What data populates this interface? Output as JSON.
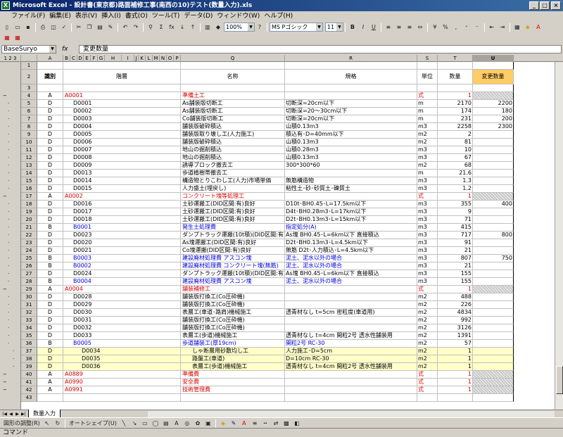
{
  "window": {
    "title": "Microsoft Excel - 設計書(東京都)路面補修工事(南西の10)テスト(数量入力).xls",
    "app_icon": "X",
    "min": "_",
    "max": "□",
    "close": "×"
  },
  "menu": [
    "ファイル(F)",
    "編集(E)",
    "表示(V)",
    "挿入(I)",
    "書式(O)",
    "ツール(T)",
    "データ(D)",
    "ウィンドウ(W)",
    "ヘルプ(H)"
  ],
  "toolbar": {
    "zoom": "100%",
    "font": "MS Pゴシック",
    "size": "11",
    "bold": "B",
    "italic": "I",
    "underline": "U",
    "percent": "%",
    "comma": ",",
    "sum": "Σ",
    "fx": "fx"
  },
  "namebox": "BaseSuryo",
  "formula_label": "fx",
  "formula": "変更数量",
  "columns": [
    "A",
    "B",
    "C",
    "D",
    "E",
    "F",
    "G",
    "H",
    "I",
    "J",
    "K",
    "L",
    "M",
    "N",
    "O",
    "P",
    "Q",
    "R",
    "S",
    "T",
    "U"
  ],
  "outline_levels": [
    "1",
    "2",
    "3"
  ],
  "header": {
    "code": "識別",
    "level": "階層",
    "name": "名称",
    "spec": "規格",
    "unit": "単位",
    "qty": "数量",
    "chg": "変更数量"
  },
  "rows": [
    {
      "n": "1"
    },
    {
      "n": "2",
      "header": true
    },
    {
      "n": "3"
    },
    {
      "n": "4",
      "a": "A",
      "code": "A0001",
      "ind": 0,
      "name": "準備土工",
      "unit": "式",
      "qty": "1",
      "color": "red",
      "hatch": true
    },
    {
      "n": "5",
      "a": "D",
      "code": "D0001",
      "ind": 1,
      "name": "As舗装版切断工",
      "spec": "切断深=20cm以下",
      "unit": "m",
      "qty": "2170",
      "chg": "2200"
    },
    {
      "n": "6",
      "a": "D",
      "code": "D0002",
      "ind": 1,
      "name": "As舗装版切断工",
      "spec": "切断深=20～30cm以下",
      "unit": "m",
      "qty": "174",
      "chg": "180"
    },
    {
      "n": "7",
      "a": "D",
      "code": "D0003",
      "ind": 1,
      "name": "Co舗装版切断工",
      "spec": "切断深=20cm以下",
      "unit": "m",
      "qty": "231",
      "chg": "200"
    },
    {
      "n": "8",
      "a": "D",
      "code": "D0004",
      "ind": 1,
      "name": "舗装版破砕積込",
      "spec": "山積0.13m3",
      "unit": "m3",
      "qty": "2258",
      "chg": "2300"
    },
    {
      "n": "9",
      "a": "D",
      "code": "D0005",
      "ind": 1,
      "name": "舗装版取り壊し工(人力施工)",
      "spec": "積込有･D=40mm以下",
      "unit": "m2",
      "qty": "2"
    },
    {
      "n": "10",
      "a": "D",
      "code": "D0006",
      "ind": 1,
      "name": "舗装版破砕積込",
      "spec": "山積0.13m3",
      "unit": "m2",
      "qty": "81"
    },
    {
      "n": "11",
      "a": "D",
      "code": "D0007",
      "ind": 1,
      "name": "地山の掘削積込",
      "spec": "山積0.28m3",
      "unit": "m3",
      "qty": "10"
    },
    {
      "n": "12",
      "a": "D",
      "code": "D0008",
      "ind": 1,
      "name": "地山の掘削積込",
      "spec": "山積0.13m3",
      "unit": "m3",
      "qty": "67"
    },
    {
      "n": "13",
      "a": "D",
      "code": "D0009",
      "ind": 1,
      "name": "誘導ブロック撤去工",
      "spec": "300*300*60",
      "unit": "m2",
      "qty": "68"
    },
    {
      "n": "14",
      "a": "D",
      "code": "D0013",
      "ind": 1,
      "name": "歩道植樹帯撤去工",
      "unit": "m",
      "qty": "21.6"
    },
    {
      "n": "15",
      "a": "D",
      "code": "D0014",
      "ind": 1,
      "name": "構造物とりこわし工(人力)市場単価",
      "spec": "無筋構造物",
      "unit": "m3",
      "qty": "1.3"
    },
    {
      "n": "16",
      "a": "D",
      "code": "D0015",
      "ind": 1,
      "name": "人力盛土(埋戻し)",
      "spec": "粘性土･砂･砂質土･礫質土",
      "unit": "m3",
      "qty": "1.2"
    },
    {
      "n": "17",
      "a": "A",
      "code": "A0002",
      "ind": 0,
      "name": "コンクリート塊等処理工",
      "unit": "式",
      "qty": "1",
      "color": "red",
      "hatch": true
    },
    {
      "n": "18",
      "a": "D",
      "code": "D0016",
      "ind": 1,
      "name": "土砂運搬工(DID区間:有)良好",
      "spec": "D10t･BH0.45･L=17.5km以下",
      "unit": "m3",
      "qty": "355",
      "chg": "400"
    },
    {
      "n": "19",
      "a": "D",
      "code": "D0017",
      "ind": 1,
      "name": "土砂運搬工(DID区間:有)良好",
      "spec": "D4t･BH0.28m3･L=17km以下",
      "unit": "m3",
      "qty": "9"
    },
    {
      "n": "20",
      "a": "D",
      "code": "D0018",
      "ind": 1,
      "name": "土砂運搬工(DID区間:有)良好",
      "spec": "D2t･BH0.13m3･L=15km以下",
      "unit": "m3",
      "qty": "71"
    },
    {
      "n": "21",
      "a": "B",
      "code": "B0001",
      "ind": 1,
      "name": "発生土処理費",
      "spec": "指定処分(A)",
      "unit": "m3",
      "qty": "415",
      "color": "blue"
    },
    {
      "n": "22",
      "a": "D",
      "code": "D0023",
      "ind": 1,
      "name": "ダンプトラック運搬(10t積)(DID区間:有)良好 舗装版",
      "spec": "As塊 BH0.45･L=6km以下 直接積込",
      "unit": "m3",
      "qty": "717",
      "chg": "800"
    },
    {
      "n": "23",
      "a": "D",
      "code": "D0020",
      "ind": 1,
      "name": "As塊運搬工(DID区間:有)良好",
      "spec": "D2t･BH0.13m3･L=4.5km以下",
      "unit": "m3",
      "qty": "91"
    },
    {
      "n": "24",
      "a": "D",
      "code": "D0021",
      "ind": 1,
      "name": "Co塊運搬(DID区間:有)良好",
      "spec": "無筋 D2t･人力積込･L=4.5km以下",
      "unit": "m3",
      "qty": "21"
    },
    {
      "n": "25",
      "a": "B",
      "code": "B0003",
      "ind": 1,
      "name": "建設廃材処理費 アスコン塊",
      "spec": "泥土、泥水以外の場合",
      "unit": "m3",
      "qty": "807",
      "chg": "750",
      "color": "blue"
    },
    {
      "n": "26",
      "a": "B",
      "code": "B0002",
      "ind": 1,
      "name": "建設廃材処理費 コンクリート塊(無筋)",
      "spec": "泥土、泥水以外の場合",
      "unit": "m3",
      "qty": "21",
      "color": "blue"
    },
    {
      "n": "27",
      "a": "D",
      "code": "D0024",
      "ind": 1,
      "name": "ダンプトラック運搬(10t積)(DID区間:有)良好 舗装版",
      "spec": "As塊 BH0.45･L=6km以下 直接積込",
      "unit": "m3",
      "qty": "155"
    },
    {
      "n": "28",
      "a": "B",
      "code": "B0004",
      "ind": 1,
      "name": "建設廃材処理費 アスコン塊",
      "spec": "泥土、泥水以外の場合",
      "unit": "m3",
      "qty": "155",
      "color": "blue"
    },
    {
      "n": "29",
      "a": "A",
      "code": "A0004",
      "ind": 0,
      "name": "舗装補修工",
      "unit": "式",
      "qty": "1",
      "color": "red",
      "hatch": true
    },
    {
      "n": "30",
      "a": "D",
      "code": "D0028",
      "ind": 1,
      "name": "舗装版打換工(Co圧砕機)",
      "unit": "m2",
      "qty": "488"
    },
    {
      "n": "31",
      "a": "D",
      "code": "D0029",
      "ind": 1,
      "name": "舗装版打換工(Co圧砕機)",
      "unit": "m2",
      "qty": "226"
    },
    {
      "n": "32",
      "a": "D",
      "code": "D0030",
      "ind": 1,
      "name": "表層工(車道･路肩)機械施工",
      "spec": "透青材なし t=5cm 密粒度(車道用)",
      "unit": "m2",
      "qty": "4834"
    },
    {
      "n": "33",
      "a": "D",
      "code": "D0031",
      "ind": 1,
      "name": "舗装版打換工(Co圧砕機)",
      "unit": "m2",
      "qty": "992"
    },
    {
      "n": "34",
      "a": "D",
      "code": "D0032",
      "ind": 1,
      "name": "舗装版打換工(Co圧砕機)",
      "unit": "m2",
      "qty": "3126"
    },
    {
      "n": "35",
      "a": "D",
      "code": "D0033",
      "ind": 1,
      "name": "表層工(歩道)機械施工",
      "spec": "透青材なし t=4cm 開粒2号 透水性舗装用",
      "unit": "m2",
      "qty": "1391"
    },
    {
      "n": "36",
      "a": "B",
      "code": "B0005",
      "ind": 1,
      "name": "歩道舗装工(厚19cm)",
      "spec": "開粒2号 RC-30",
      "unit": "m2",
      "qty": "57",
      "color": "blue"
    },
    {
      "n": "37",
      "a": "D",
      "code": "D0034",
      "ind": 2,
      "name": "しゃ断層用砂敷均し工",
      "spec": "人力施工･D=5cm",
      "unit": "m2",
      "qty": "1",
      "yellow": true
    },
    {
      "n": "38",
      "a": "D",
      "code": "D0035",
      "ind": 2,
      "name": "路盤工(車道)",
      "spec": "D=10cm RC-30",
      "unit": "m2",
      "qty": "1",
      "yellow": true
    },
    {
      "n": "39",
      "a": "D",
      "code": "D0036",
      "ind": 2,
      "name": "表層工(歩道)機械施工",
      "spec": "透青材なし t=4cm 開粒2号 透水性舗装用",
      "unit": "m2",
      "qty": "1",
      "yellow": true
    },
    {
      "n": "40",
      "a": "A",
      "code": "A0889",
      "ind": 0,
      "name": "準備費",
      "unit": "式",
      "qty": "1",
      "color": "red",
      "hatch": true
    },
    {
      "n": "41",
      "a": "A",
      "code": "A0990",
      "ind": 0,
      "name": "安全費",
      "unit": "式",
      "qty": "1",
      "color": "red",
      "hatch": true
    },
    {
      "n": "42",
      "a": "A",
      "code": "A0991",
      "ind": 0,
      "name": "技術管理費",
      "unit": "式",
      "qty": "1",
      "color": "red",
      "hatch": true
    },
    {
      "n": "43"
    }
  ],
  "sheet_tab": "数量入力",
  "draw_toolbar": {
    "draw": "図形の調整(R)",
    "autoshape": "オートシェイプ(U)"
  },
  "status": "コマンド"
}
